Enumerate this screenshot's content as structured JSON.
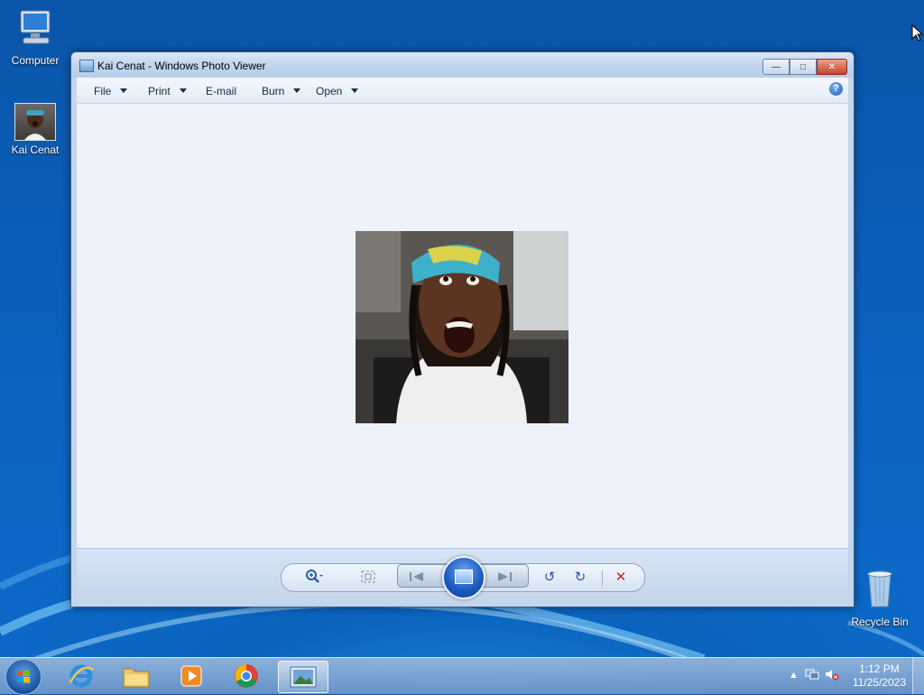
{
  "desktop": {
    "icons": {
      "computer": "Computer",
      "kai": "Kai Cenat",
      "recycle": "Recycle Bin"
    }
  },
  "window": {
    "title": "Kai Cenat - Windows Photo Viewer",
    "menu": {
      "file": "File",
      "print": "Print",
      "email": "E-mail",
      "burn": "Burn",
      "open": "Open"
    },
    "help": "?"
  },
  "taskbar": {
    "time": "1:12 PM",
    "date": "11/25/2023"
  }
}
